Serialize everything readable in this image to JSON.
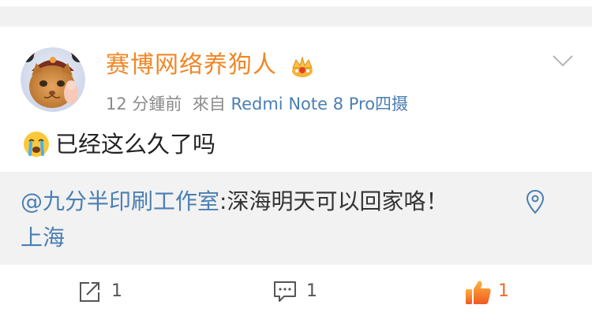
{
  "post": {
    "username": "赛博网络养狗人",
    "time": "12 分鍾前",
    "source_prefix": "來自",
    "device": "Redmi Note 8 Pro四摄",
    "text": "已经这么久了吗"
  },
  "quote": {
    "mention": "@九分半印刷工作室",
    "separator": ":",
    "text": "深海明天可以回家咯！",
    "location": "上海"
  },
  "actions": {
    "repost_count": "1",
    "comment_count": "1",
    "like_count": "1"
  },
  "colors": {
    "username": "#f08726",
    "link": "#4a7fb3",
    "like": "#f06a2a",
    "quote_bg": "#f2f2f2"
  }
}
